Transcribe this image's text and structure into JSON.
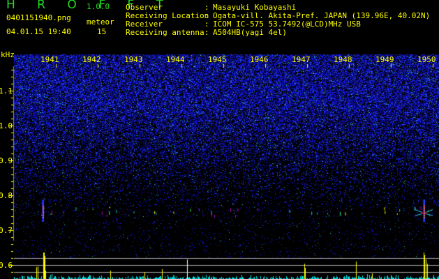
{
  "app": {
    "name": "H R O F F T",
    "version": "1.0.0"
  },
  "file": {
    "name": "0401151940.png",
    "datetime": "04.01.15 19:40"
  },
  "meteor": {
    "label": "meteor",
    "count": "15"
  },
  "info": [
    {
      "label": "Observer",
      "sep": ":",
      "value": "Masayuki Kobayashi"
    },
    {
      "label": "Receiving Location",
      "sep": ":",
      "value": "Ogata-vill. Akita-Pref. JAPAN (139.96E, 40.02N)"
    },
    {
      "label": "Receiver",
      "sep": ":",
      "value": "ICOM IC-575 53.7492(@LCD)MHz USB"
    },
    {
      "label": "Receiving antenna",
      "sep": ":",
      "value": "A504HB(yagi 4el)"
    }
  ],
  "spectrogram": {
    "y_unit": "kHz",
    "y_ticks": [
      "1.1",
      "1.0",
      "0.9",
      "0.8",
      "0.7",
      "0.6"
    ],
    "x_ticks": [
      "1941",
      "1942",
      "1943",
      "1944",
      "1945",
      "1946",
      "1947",
      "1948",
      "1949",
      "1950"
    ],
    "colors": {
      "noise": "#1a1aff",
      "axis": "#ffff00",
      "histogram": "#00e5e5",
      "meteor_spike": "#ffff00",
      "guide_lines": "#a0a0a0"
    }
  }
}
